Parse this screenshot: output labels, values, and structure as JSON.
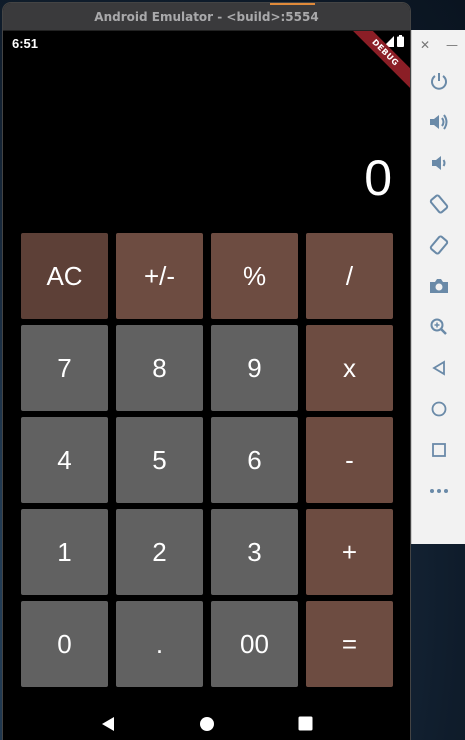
{
  "window": {
    "title": "Android Emulator - <build>:5554"
  },
  "status_bar": {
    "time": "6:51",
    "debug_label": "DEBUG"
  },
  "display": {
    "value": "0"
  },
  "keypad": {
    "rows": [
      [
        {
          "label": "AC",
          "type": "op",
          "name": "clear"
        },
        {
          "label": "+/-",
          "type": "op",
          "name": "negate"
        },
        {
          "label": "%",
          "type": "op",
          "name": "percent"
        },
        {
          "label": "/",
          "type": "op",
          "name": "divide"
        }
      ],
      [
        {
          "label": "7",
          "type": "num",
          "name": "7"
        },
        {
          "label": "8",
          "type": "num",
          "name": "8"
        },
        {
          "label": "9",
          "type": "num",
          "name": "9"
        },
        {
          "label": "x",
          "type": "op",
          "name": "multiply"
        }
      ],
      [
        {
          "label": "4",
          "type": "num",
          "name": "4"
        },
        {
          "label": "5",
          "type": "num",
          "name": "5"
        },
        {
          "label": "6",
          "type": "num",
          "name": "6"
        },
        {
          "label": "-",
          "type": "op",
          "name": "subtract"
        }
      ],
      [
        {
          "label": "1",
          "type": "num",
          "name": "1"
        },
        {
          "label": "2",
          "type": "num",
          "name": "2"
        },
        {
          "label": "3",
          "type": "num",
          "name": "3"
        },
        {
          "label": "+",
          "type": "op",
          "name": "add"
        }
      ],
      [
        {
          "label": "0",
          "type": "num",
          "name": "0"
        },
        {
          "label": ".",
          "type": "num",
          "name": "decimal"
        },
        {
          "label": "00",
          "type": "num",
          "name": "double-zero"
        },
        {
          "label": "=",
          "type": "op",
          "name": "equals"
        }
      ]
    ]
  },
  "nav_bar": {
    "icons": [
      "back-icon",
      "home-icon",
      "recents-icon"
    ]
  },
  "side_toolbar": {
    "window_controls": [
      "close-icon",
      "minimize-icon"
    ],
    "tools": [
      "power-icon",
      "volume-up-icon",
      "volume-down-icon",
      "rotate-left-icon",
      "rotate-right-icon",
      "camera-icon",
      "zoom-icon",
      "back-icon",
      "home-icon",
      "overview-icon",
      "more-icon"
    ]
  },
  "colors": {
    "operator_key": "#6d4c41",
    "number_key": "#616161",
    "screen_bg": "#000000",
    "debug_ribbon": "#8b1e26"
  }
}
